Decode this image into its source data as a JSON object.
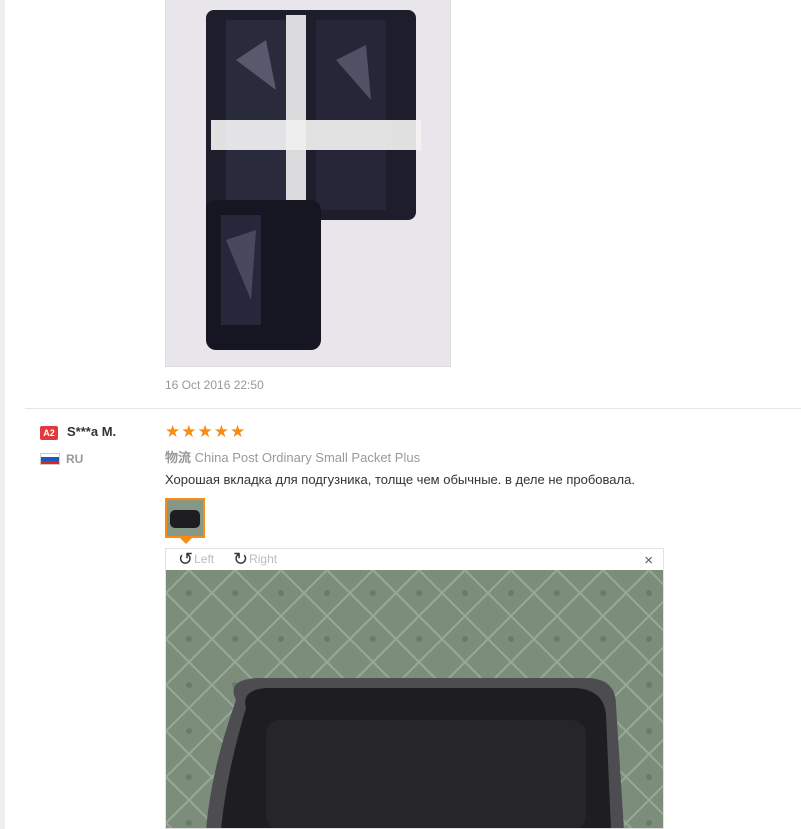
{
  "review1": {
    "date": "16 Oct 2016 22:50"
  },
  "review2": {
    "badge": "A2",
    "username": "S***a M.",
    "country": "RU",
    "rating": 5,
    "shipping_label": "物流",
    "shipping_method": "China Post Ordinary Small Packet Plus",
    "text": "Хорошая вкладка для подгузника, толще чем обычные. в деле не пробовала."
  },
  "viewer": {
    "rotate_left_label": "Left",
    "rotate_right_label": "Right",
    "close_glyph": "×"
  },
  "colors": {
    "star": "#fa8c16",
    "badge": "#e4393c",
    "muted_text": "#999999"
  },
  "icons": {
    "star": "star-icon",
    "rotate_left": "rotate-left-icon",
    "rotate_right": "rotate-right-icon",
    "close": "close-icon"
  }
}
